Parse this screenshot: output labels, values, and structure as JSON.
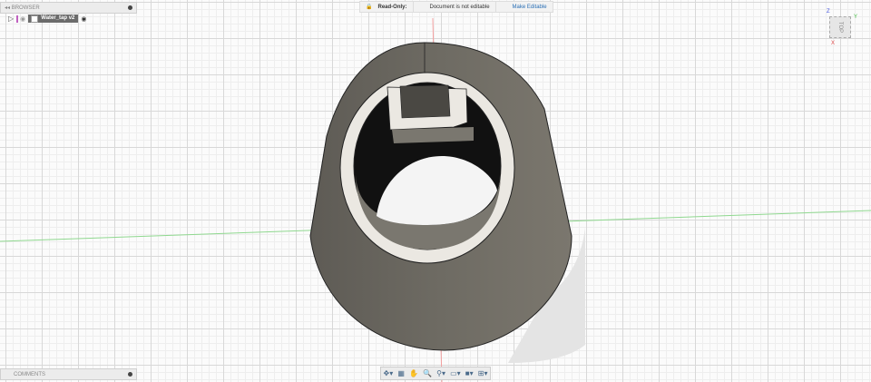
{
  "browser": {
    "title": "BROWSER",
    "component": "Water_tap v2"
  },
  "comments": {
    "title": "COMMENTS"
  },
  "banner": {
    "label": "Read-Only:",
    "message": "Document is not editable",
    "action": "Make Editable"
  },
  "viewcube": {
    "face": "TOP",
    "x": "X",
    "y": "Y",
    "z": "Z"
  },
  "colors": {
    "accent": "#2a6fb5",
    "model": "#6e6b63",
    "ring": "#ebe8e2"
  }
}
